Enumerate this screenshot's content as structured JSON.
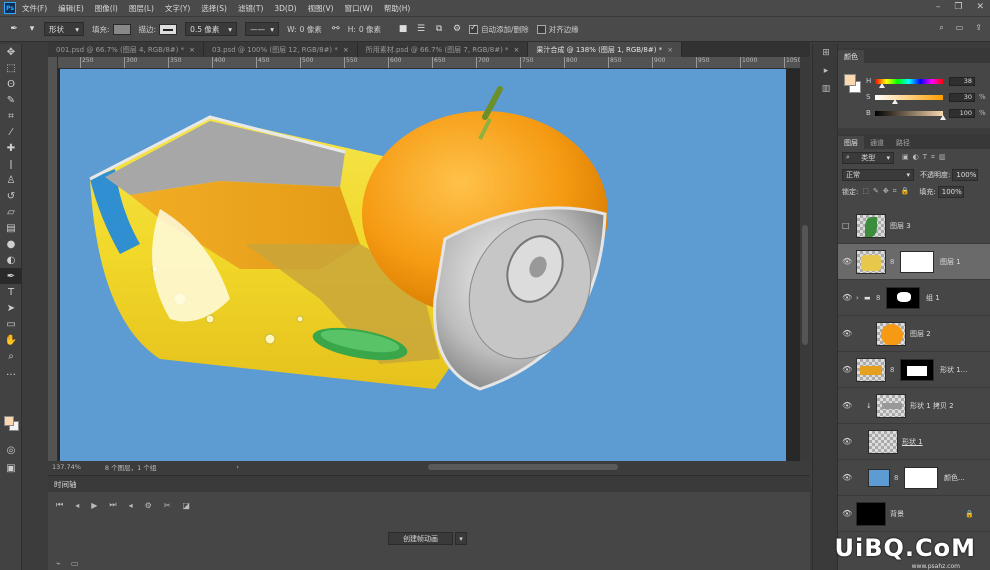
{
  "menubar": {
    "logo": "Ps",
    "items": [
      "文件(F)",
      "编辑(E)",
      "图像(I)",
      "图层(L)",
      "文字(Y)",
      "选择(S)",
      "滤镜(T)",
      "3D(D)",
      "视图(V)",
      "窗口(W)",
      "帮助(H)"
    ]
  },
  "options": {
    "shape_mode": "形状",
    "fill_label": "填充:",
    "stroke_label": "描边:",
    "stroke_width": "0.5 像素",
    "w_label": "W:",
    "w_value": "0 像素",
    "h_label": "H:",
    "h_value": "0 像素",
    "auto_add_delete": "自动添加/删除",
    "align_edges": "对齐边缘"
  },
  "tabs": [
    {
      "label": "001.psd @ 66.7% (图层 4, RGB/8#) *",
      "active": false
    },
    {
      "label": "03.psd @ 100% (图层 12, RGB/8#) *",
      "active": false
    },
    {
      "label": "所用素材.psd @ 66.7% (图层 7, RGB/8#) *",
      "active": false
    },
    {
      "label": "果汁合成 @ 138% (图层 1, RGB/8#) *",
      "active": true
    }
  ],
  "ruler_ticks": [
    "250",
    "300",
    "350",
    "400",
    "450",
    "500",
    "550",
    "600",
    "650",
    "700",
    "750",
    "800",
    "850",
    "900",
    "950",
    "1000",
    "1050"
  ],
  "status": {
    "zoom": "137.74%",
    "info": "8 个图层，1 个组"
  },
  "timeline": {
    "title": "时间轴",
    "create_button": "创建帧动画"
  },
  "color_panel": {
    "title": "颜色",
    "sliders": [
      {
        "label": "H",
        "value": "38",
        "unit": "",
        "position": 0.105
      },
      {
        "label": "S",
        "value": "30",
        "unit": "%",
        "position": 0.3
      },
      {
        "label": "B",
        "value": "100",
        "unit": "%",
        "position": 1.0
      }
    ],
    "foreground": "#fbd8b0"
  },
  "layers_panel": {
    "tabs": [
      "图层",
      "通道",
      "路径"
    ],
    "filter_kind": "类型",
    "blend_mode": "正常",
    "opacity_label": "不透明度:",
    "opacity_value": "100%",
    "lock_label": "锁定:",
    "fill_label": "填充:",
    "fill_value": "100%",
    "layers": [
      {
        "name": "图层 3",
        "visible": false,
        "selected": false
      },
      {
        "name": "图层 1",
        "visible": true,
        "selected": true
      },
      {
        "name": "组 1",
        "visible": true,
        "selected": false
      },
      {
        "name": "图层 2",
        "visible": true,
        "selected": false
      },
      {
        "name": "形状 1...",
        "visible": true,
        "selected": false
      },
      {
        "name": "形状 1 拷贝 2",
        "visible": true,
        "selected": false
      },
      {
        "name": "形状 1",
        "visible": true,
        "selected": false
      },
      {
        "name": "颜色...",
        "visible": true,
        "selected": false
      },
      {
        "name": "背景",
        "visible": true,
        "selected": false
      }
    ]
  },
  "watermark": {
    "logo": "UiBQ.CoM",
    "sub": "www.psahz.com"
  }
}
